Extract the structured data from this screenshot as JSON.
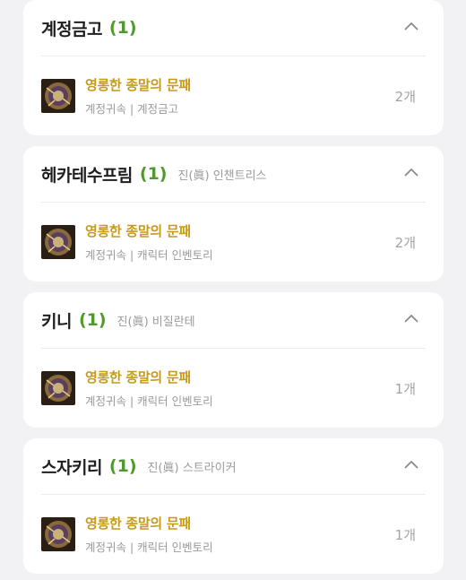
{
  "cards": [
    {
      "character": "계정금고",
      "count": "(1)",
      "job": "",
      "item": {
        "name": "영롱한 종말의 문패",
        "meta": "계정귀속 | 계정금고",
        "quantity": "2개",
        "icon": "nameplate-icon"
      }
    },
    {
      "character": "헤카테수프림",
      "count": "(1)",
      "job": "진(眞) 인챈트리스",
      "item": {
        "name": "영롱한 종말의 문패",
        "meta": "계정귀속 | 캐릭터 인벤토리",
        "quantity": "2개",
        "icon": "nameplate-icon"
      }
    },
    {
      "character": "키니",
      "count": "(1)",
      "job": "진(眞) 비질란테",
      "item": {
        "name": "영롱한 종말의 문패",
        "meta": "계정귀속 | 캐릭터 인벤토리",
        "quantity": "1개",
        "icon": "nameplate-icon"
      }
    },
    {
      "character": "스자키리",
      "count": "(1)",
      "job": "진(眞) 스트라이커",
      "item": {
        "name": "영롱한 종말의 문패",
        "meta": "계정귀속 | 캐릭터 인벤토리",
        "quantity": "1개",
        "icon": "nameplate-icon"
      }
    }
  ],
  "colors": {
    "accent_count": "#4e9a2b",
    "item_name": "#c79a1d",
    "muted": "#9a9a9a",
    "background": "#f2f2f4"
  }
}
